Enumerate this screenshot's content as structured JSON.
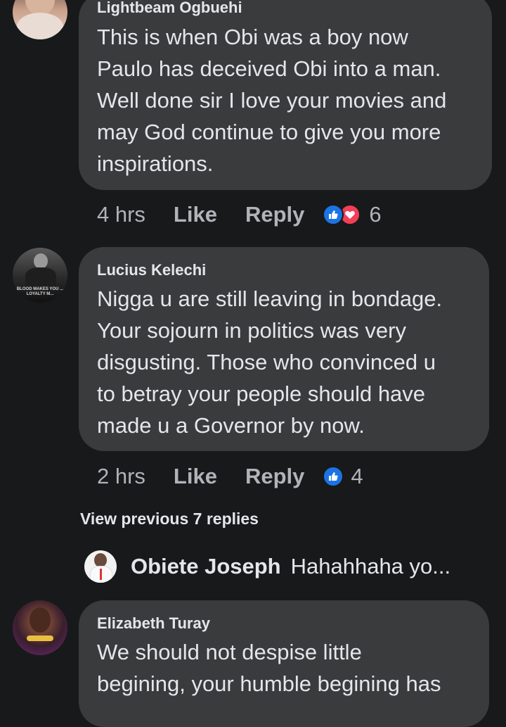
{
  "comments": [
    {
      "author": "Lightbeam Ogbuehi",
      "text": "This is when Obi was a boy now\nPaulo has deceived Obi into a man.\nWell done sir I love your movies and\nmay God continue to give you more\ninspirations.",
      "time": "4 hrs",
      "like_label": "Like",
      "reply_label": "Reply",
      "reaction_count": "6",
      "reactions": [
        "like-icon",
        "love-icon"
      ]
    },
    {
      "author": "Lucius Kelechi",
      "avatar_caption": "BLOOD MAKES YOU ... LOYALTY M...",
      "text": "Nigga u are still leaving in bondage.\nYour sojourn in politics was very\ndisgusting. Those who convinced u\nto betray your people should have\nmade u a Governor by now.",
      "time": "2 hrs",
      "like_label": "Like",
      "reply_label": "Reply",
      "reaction_count": "4",
      "reactions": [
        "like-icon"
      ]
    },
    {
      "author": "Elizabeth Turay",
      "text": "We should not despise little\nbegining, your humble begining has"
    }
  ],
  "view_previous": "View previous 7 replies",
  "reply_preview": {
    "author": "Obiete Joseph",
    "text": "Hahahhaha yo..."
  },
  "colors": {
    "background": "#18191a",
    "bubble": "#3a3b3c",
    "like_blue": "#1b74e4",
    "love_red": "#f33e58",
    "secondary_text": "#b0b3b8"
  }
}
